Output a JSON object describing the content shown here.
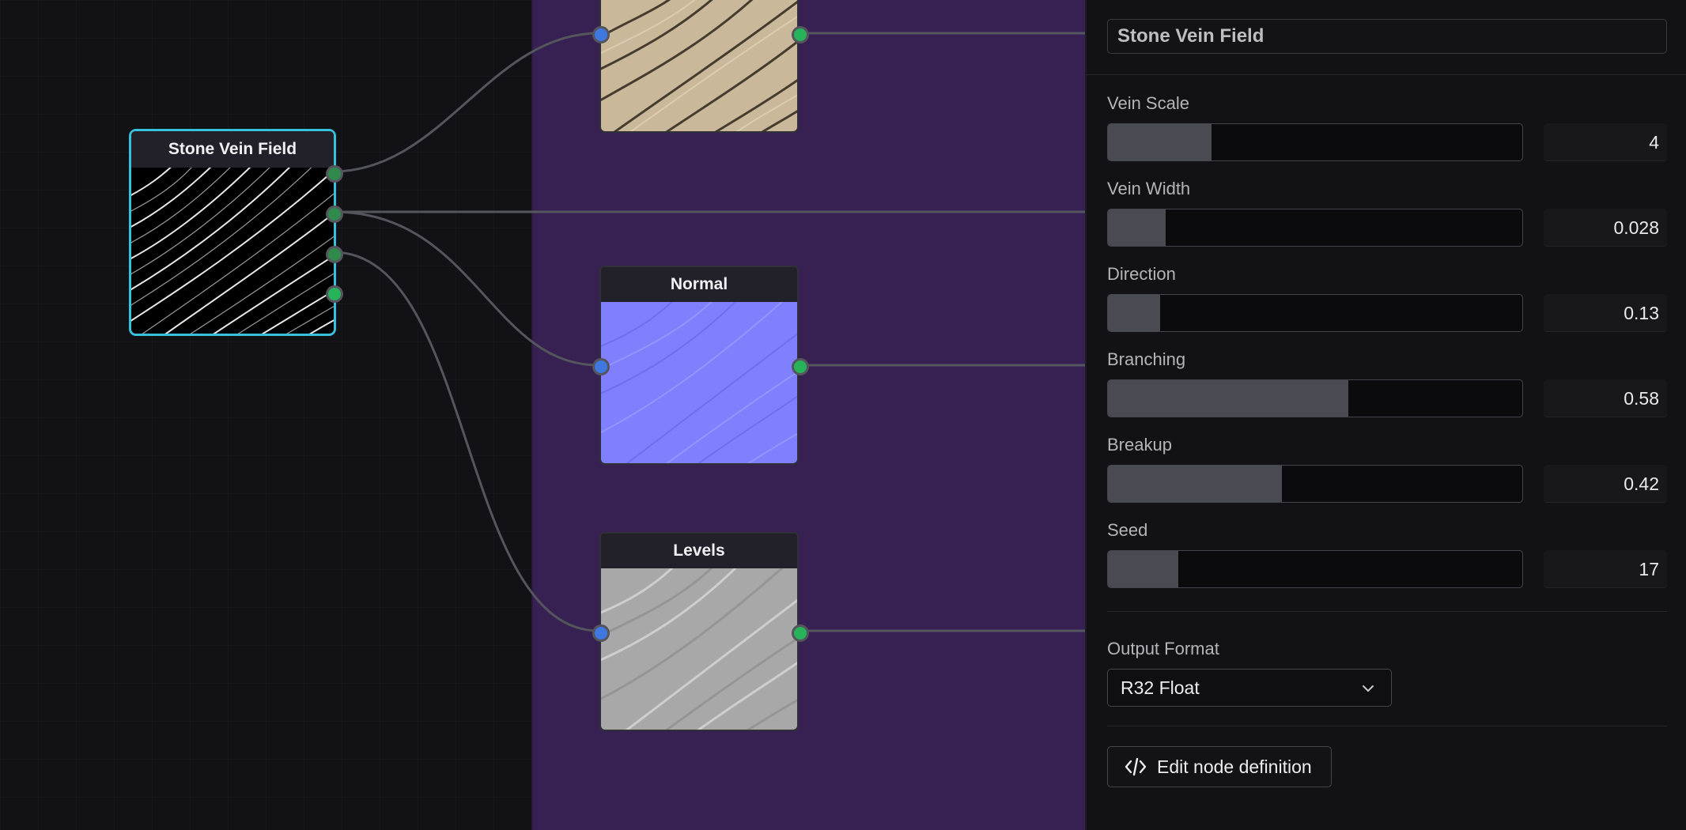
{
  "canvas": {
    "nodes": {
      "source": {
        "title": "Stone Vein Field"
      },
      "normal": {
        "title": "Normal"
      },
      "levels": {
        "title": "Levels"
      }
    }
  },
  "panel": {
    "node_name": "Stone Vein Field",
    "params": [
      {
        "label": "Vein Scale",
        "value": "4",
        "fill": 0.25
      },
      {
        "label": "Vein Width",
        "value": "0.028",
        "fill": 0.14
      },
      {
        "label": "Direction",
        "value": "0.13",
        "fill": 0.125
      },
      {
        "label": "Branching",
        "value": "0.58",
        "fill": 0.58
      },
      {
        "label": "Breakup",
        "value": "0.42",
        "fill": 0.42
      },
      {
        "label": "Seed",
        "value": "17",
        "fill": 0.17
      }
    ],
    "output_format": {
      "label": "Output Format",
      "value": "R32 Float"
    },
    "edit_button": "Edit node definition"
  },
  "colors": {
    "selection": "#38c2da",
    "frame": "#372152",
    "port_in": "#3f78e0",
    "port_out": "#27b35a",
    "normal_map": "#8080ff"
  },
  "icons": [
    "chevron-down-icon",
    "code-icon"
  ]
}
